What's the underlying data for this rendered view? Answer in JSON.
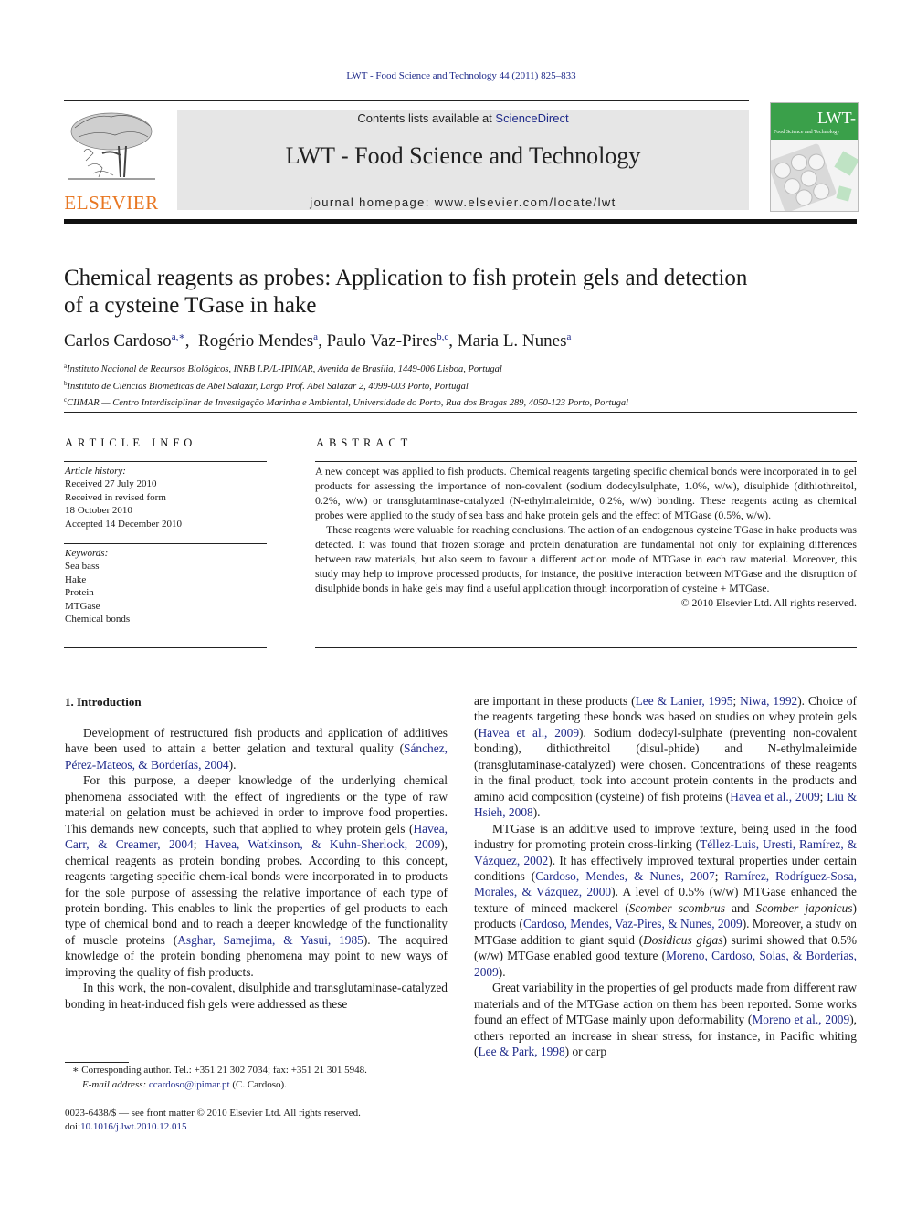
{
  "running_head": "LWT - Food Science and Technology 44 (2011) 825–833",
  "masthead": {
    "contents_prefix": "Contents lists available at ",
    "contents_link": "ScienceDirect",
    "journal_title": "LWT - Food Science and Technology",
    "homepage": "journal homepage: www.elsevier.com/locate/lwt",
    "publisher_logo": "ELSEVIER",
    "cover": {
      "title": "LWT-",
      "subtitle": "Food Science and Technology",
      "accent": "#3aa04a"
    },
    "logo_color": "#e87722"
  },
  "article": {
    "title_line1": "Chemical reagents as probes: Application to fish protein gels and detection",
    "title_line2": "of a cysteine TGase in hake",
    "authors": [
      {
        "name": "Carlos Cardoso",
        "sup": "a,∗",
        "sep": ",  "
      },
      {
        "name": "Rogério Mendes",
        "sup": "a",
        "sep": ", "
      },
      {
        "name": "Paulo Vaz-Pires",
        "sup": "b,c",
        "sep": ", "
      },
      {
        "name": "Maria L. Nunes",
        "sup": "a",
        "sep": ""
      }
    ],
    "affiliations": [
      {
        "key": "a",
        "text": "Instituto Nacional de Recursos Biológicos, INRB I.P./L-IPIMAR, Avenida de Brasília, 1449-006 Lisboa, Portugal"
      },
      {
        "key": "b",
        "text": "Instituto de Ciências Biomédicas de Abel Salazar, Largo Prof. Abel Salazar 2, 4099-003 Porto, Portugal"
      },
      {
        "key": "c",
        "text": "CIIMAR — Centro Interdisciplinar de Investigação Marinha e Ambiental, Universidade do Porto, Rua dos Bragas 289, 4050-123 Porto, Portugal"
      }
    ]
  },
  "article_info": {
    "heading": "ARTICLE INFO",
    "history_label": "Article history:",
    "history": [
      "Received 27 July 2010",
      "Received in revised form",
      "18 October 2010",
      "Accepted 14 December 2010"
    ],
    "keywords_label": "Keywords:",
    "keywords": [
      "Sea bass",
      "Hake",
      "Protein",
      "MTGase",
      "Chemical bonds"
    ]
  },
  "abstract": {
    "heading": "ABSTRACT",
    "p1": "A new concept was applied to fish products. Chemical reagents targeting specific chemical bonds were incorporated in to gel products for assessing the importance of non-covalent (sodium dodecylsulphate, 1.0%, w/w), disulphide (dithiothreitol, 0.2%, w/w) or transglutaminase-catalyzed (N-ethylmaleimide, 0.2%, w/w) bonding. These reagents acting as chemical probes were applied to the study of sea bass and hake protein gels and the effect of MTGase (0.5%, w/w).",
    "p2": "These reagents were valuable for reaching conclusions. The action of an endogenous cysteine TGase in hake products was detected. It was found that frozen storage and protein denaturation are fundamental not only for explaining differences between raw materials, but also seem to favour a different action mode of MTGase in each raw material. Moreover, this study may help to improve processed products, for instance, the positive interaction between MTGase and the disruption of disulphide bonds in hake gels may find a useful application through incorporation of cysteine + MTGase.",
    "copyright": "© 2010 Elsevier Ltd. All rights reserved."
  },
  "intro": {
    "heading": "1.  Introduction",
    "left": [
      {
        "indent": true,
        "parts": [
          {
            "t": "Development of restructured fish products and application of additives have been used to attain a better gelation and textural quality ("
          },
          {
            "t": "Sánchez, Pérez-Mateos, & Borderías, 2004",
            "link": true
          },
          {
            "t": ")."
          }
        ]
      },
      {
        "indent": true,
        "parts": [
          {
            "t": "For this purpose, a deeper knowledge of the underlying chemical phenomena associated with the effect of ingredients or the type of raw material on gelation must be achieved in order to improve food properties. This demands new concepts, such that applied to whey protein gels ("
          },
          {
            "t": "Havea, Carr, & Creamer, 2004",
            "link": true
          },
          {
            "t": "; "
          },
          {
            "t": "Havea, Watkinson, & Kuhn-Sherlock, 2009",
            "link": true
          },
          {
            "t": "), chemical reagents as protein bonding probes. According to this concept, reagents targeting specific chem-ical bonds were incorporated in to products for the sole purpose of assessing the relative importance of each type of protein bonding. This enables to link the properties of gel products to each type of chemical bond and to reach a deeper knowledge of the functionality of muscle proteins ("
          },
          {
            "t": "Asghar, Samejima, & Yasui, 1985",
            "link": true
          },
          {
            "t": "). The acquired knowledge of the protein bonding phenomena may point to new ways of improving the quality of fish products."
          }
        ]
      },
      {
        "indent": true,
        "parts": [
          {
            "t": "In this work, the non-covalent, disulphide and transglutaminase-catalyzed bonding in heat-induced fish gels were addressed as these"
          }
        ]
      }
    ],
    "right": [
      {
        "indent": false,
        "parts": [
          {
            "t": "are important in these products ("
          },
          {
            "t": "Lee & Lanier, 1995",
            "link": true
          },
          {
            "t": "; "
          },
          {
            "t": "Niwa, 1992",
            "link": true
          },
          {
            "t": "). Choice of the reagents targeting these bonds was based on studies on whey protein gels ("
          },
          {
            "t": "Havea et al., 2009",
            "link": true
          },
          {
            "t": "). Sodium dodecyl-sulphate (preventing non-covalent bonding), dithiothreitol (disul-phide) and N-ethylmaleimide (transglutaminase-catalyzed) were chosen. Concentrations of these reagents in the final product, took into account protein contents in the products and amino acid composition (cysteine) of fish proteins ("
          },
          {
            "t": "Havea et al., 2009",
            "link": true
          },
          {
            "t": "; "
          },
          {
            "t": "Liu & Hsieh, 2008",
            "link": true
          },
          {
            "t": ")."
          }
        ]
      },
      {
        "indent": true,
        "parts": [
          {
            "t": "MTGase is an additive used to improve texture, being used in the food industry for promoting protein cross-linking ("
          },
          {
            "t": "Téllez-Luis, Uresti, Ramírez, & Vázquez, 2002",
            "link": true
          },
          {
            "t": "). It has effectively improved textural properties under certain conditions ("
          },
          {
            "t": "Cardoso, Mendes, & Nunes, 2007",
            "link": true
          },
          {
            "t": "; "
          },
          {
            "t": "Ramírez, Rodríguez-Sosa, Morales, & Vázquez, 2000",
            "link": true
          },
          {
            "t": "). A level of 0.5% (w/w) MTGase enhanced the texture of minced mackerel ("
          },
          {
            "t": "Scomber scombrus",
            "italic": true
          },
          {
            "t": " and "
          },
          {
            "t": "Scomber japonicus",
            "italic": true
          },
          {
            "t": ") products ("
          },
          {
            "t": "Cardoso, Mendes, Vaz-Pires, & Nunes, 2009",
            "link": true
          },
          {
            "t": "). Moreover, a study on MTGase addition to giant squid ("
          },
          {
            "t": "Dosidicus gigas",
            "italic": true
          },
          {
            "t": ") surimi showed that 0.5% (w/w) MTGase enabled good texture ("
          },
          {
            "t": "Moreno, Cardoso, Solas, & Borderías, 2009",
            "link": true
          },
          {
            "t": ")."
          }
        ]
      },
      {
        "indent": true,
        "parts": [
          {
            "t": "Great variability in the properties of gel products made from different raw materials and of the MTGase action on them has been reported. Some works found an effect of MTGase mainly upon deformability ("
          },
          {
            "t": "Moreno et al., 2009",
            "link": true
          },
          {
            "t": "), others reported an increase in shear stress, for instance, in Pacific whiting ("
          },
          {
            "t": "Lee & Park, 1998",
            "link": true
          },
          {
            "t": ") or carp"
          }
        ]
      }
    ]
  },
  "footnotes": {
    "corresponding": "∗  Corresponding author. Tel.: +351 21 302 7034; fax: +351 21 301 5948.",
    "email_label": "E-mail address: ",
    "email": "ccardoso@ipimar.pt",
    "email_suffix": " (C. Cardoso).",
    "issn_line": "0023-6438/$ — see front matter © 2010 Elsevier Ltd. All rights reserved.",
    "doi_label": "doi:",
    "doi": "10.1016/j.lwt.2010.12.015"
  }
}
